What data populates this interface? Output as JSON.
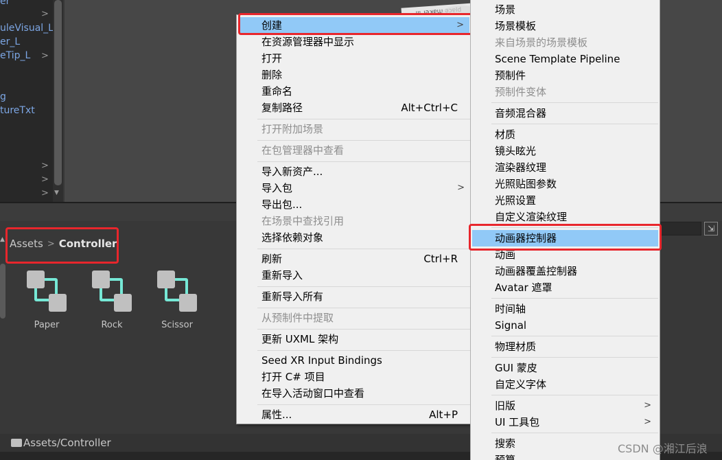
{
  "hierarchy": {
    "items": [
      {
        "label": "er"
      },
      {
        "label": "uleVisual_L"
      },
      {
        "label": "er_L"
      },
      {
        "label": "eTip_L"
      },
      {
        "label": "g"
      },
      {
        "label": "tureTxt"
      }
    ]
  },
  "scene": {
    "sign_text": "ᴉᴉᴉ ɹǝʞɐɯ ǝɔɐld"
  },
  "project": {
    "breadcrumb": {
      "root": "Assets",
      "current": "Controller"
    },
    "assets": [
      {
        "label": "Paper"
      },
      {
        "label": "Rock"
      },
      {
        "label": "Scissor"
      }
    ],
    "status_path": "Assets/Controller"
  },
  "context_menu": {
    "items": [
      {
        "label": "创建",
        "submenu": true,
        "highlighted": true
      },
      {
        "label": "在资源管理器中显示"
      },
      {
        "label": "打开"
      },
      {
        "label": "删除"
      },
      {
        "label": "重命名"
      },
      {
        "label": "复制路径",
        "shortcut": "Alt+Ctrl+C"
      },
      {
        "label": "打开附加场景",
        "disabled": true
      },
      {
        "label": "在包管理器中查看",
        "disabled": true
      },
      {
        "label": "导入新资产..."
      },
      {
        "label": "导入包",
        "submenu": true
      },
      {
        "label": "导出包..."
      },
      {
        "label": "在场景中查找引用",
        "disabled": true
      },
      {
        "label": "选择依赖对象"
      },
      {
        "label": "刷新",
        "shortcut": "Ctrl+R"
      },
      {
        "label": "重新导入"
      },
      {
        "label": "重新导入所有"
      },
      {
        "label": "从预制件中提取",
        "disabled": true
      },
      {
        "label": "更新 UXML 架构"
      },
      {
        "label": "Seed XR Input Bindings"
      },
      {
        "label": "打开 C# 项目"
      },
      {
        "label": "在导入活动窗口中查看"
      },
      {
        "label": "属性...",
        "shortcut": "Alt+P"
      }
    ]
  },
  "create_submenu": {
    "items": [
      {
        "label": "场景"
      },
      {
        "label": "场景模板"
      },
      {
        "label": "来自场景的场景模板",
        "disabled": true
      },
      {
        "label": "Scene Template Pipeline"
      },
      {
        "label": "预制件"
      },
      {
        "label": "预制件变体",
        "disabled": true
      },
      {
        "label": "音频混合器"
      },
      {
        "label": "材质"
      },
      {
        "label": "镜头眩光"
      },
      {
        "label": "渲染器纹理"
      },
      {
        "label": "光照贴图参数"
      },
      {
        "label": "光照设置"
      },
      {
        "label": "自定义渲染纹理"
      },
      {
        "label": "动画器控制器",
        "highlighted": true
      },
      {
        "label": "动画"
      },
      {
        "label": "动画器覆盖控制器"
      },
      {
        "label": "Avatar 遮罩"
      },
      {
        "label": "时间轴"
      },
      {
        "label": "Signal"
      },
      {
        "label": "物理材质"
      },
      {
        "label": "GUI 蒙皮"
      },
      {
        "label": "自定义字体"
      },
      {
        "label": "旧版",
        "submenu": true
      },
      {
        "label": "UI 工具包",
        "submenu": true
      },
      {
        "label": "搜索"
      },
      {
        "label": "预算"
      }
    ]
  },
  "watermark": "CSDN @湘江后浪",
  "colors": {
    "highlight": "#91c9f7",
    "annotation_red": "#e8262c",
    "link_blue": "#7ca6e4",
    "controller_teal": "#76e8d6"
  }
}
